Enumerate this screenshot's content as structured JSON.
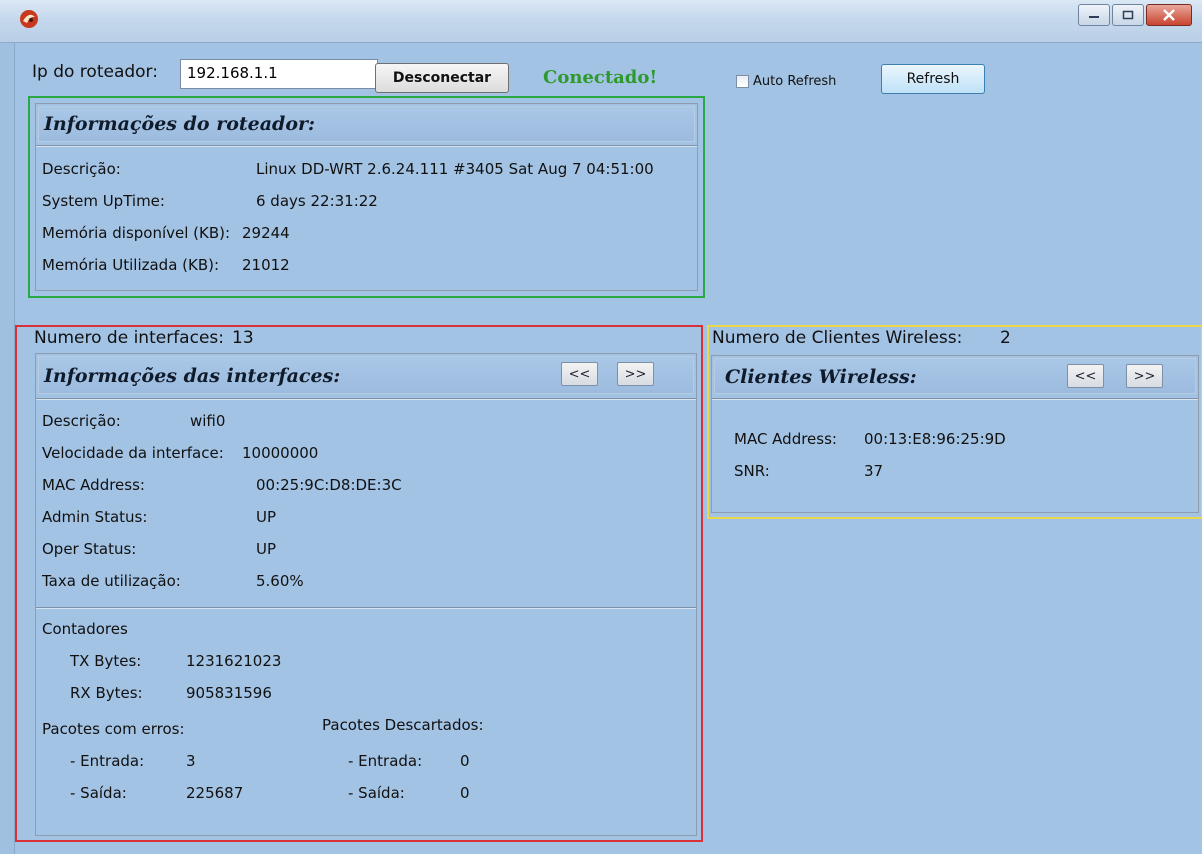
{
  "window": {
    "minimize_icon": "minimize-icon",
    "maximize_icon": "maximize-icon",
    "close_icon": "close-icon"
  },
  "connection": {
    "ip_label": "Ip do roteador:",
    "ip_value": "192.168.1.1",
    "disconnect_label": "Desconectar",
    "status_text": "Conectado!",
    "status_color": "#2e9a2e",
    "auto_refresh_label": "Auto Refresh",
    "auto_refresh_checked": false,
    "refresh_label": "Refresh"
  },
  "router_info": {
    "title": "Informações do roteador:",
    "frame_color": "#2aa845",
    "rows": [
      {
        "label": "Descrição:",
        "value": "Linux DD-WRT 2.6.24.111 #3405 Sat Aug 7 04:51:00"
      },
      {
        "label": "System UpTime:",
        "value": "6 days 22:31:22"
      },
      {
        "label": "Memória disponível (KB):",
        "value": "29244"
      },
      {
        "label": "Memória Utilizada (KB):",
        "value": "21012"
      }
    ]
  },
  "interfaces": {
    "count_label": "Numero de interfaces:",
    "count_value": "13",
    "title": "Informações das interfaces:",
    "frame_color": "#d9303a",
    "prev_label": "<<",
    "next_label": ">>",
    "rows": [
      {
        "label": "Descrição:",
        "value": "wifi0"
      },
      {
        "label": "Velocidade da interface:",
        "value": "10000000"
      },
      {
        "label": "MAC Address:",
        "value": "00:25:9C:D8:DE:3C"
      },
      {
        "label": "Admin Status:",
        "value": "UP"
      },
      {
        "label": "Oper Status:",
        "value": "UP"
      },
      {
        "label": "Taxa de utilização:",
        "value": "5.60%"
      }
    ],
    "counters": {
      "title": "Contadores",
      "tx_label": "TX Bytes:",
      "tx_value": "1231621023",
      "rx_label": "RX Bytes:",
      "rx_value": "905831596",
      "errors_title": "Pacotes com erros:",
      "discarded_title": "Pacotes Descartados:",
      "in_label": "- Entrada:",
      "out_label": "- Saída:",
      "errors_in": "3",
      "errors_out": "225687",
      "discarded_in": "0",
      "discarded_out": "0"
    }
  },
  "wireless": {
    "count_label": "Numero de Clientes Wireless:",
    "count_value": "2",
    "title": "Clientes Wireless:",
    "frame_color": "#e8d84a",
    "prev_label": "<<",
    "next_label": ">>",
    "mac_label": "MAC Address:",
    "mac_value": "00:13:E8:96:25:9D",
    "snr_label": "SNR:",
    "snr_value": "37"
  }
}
